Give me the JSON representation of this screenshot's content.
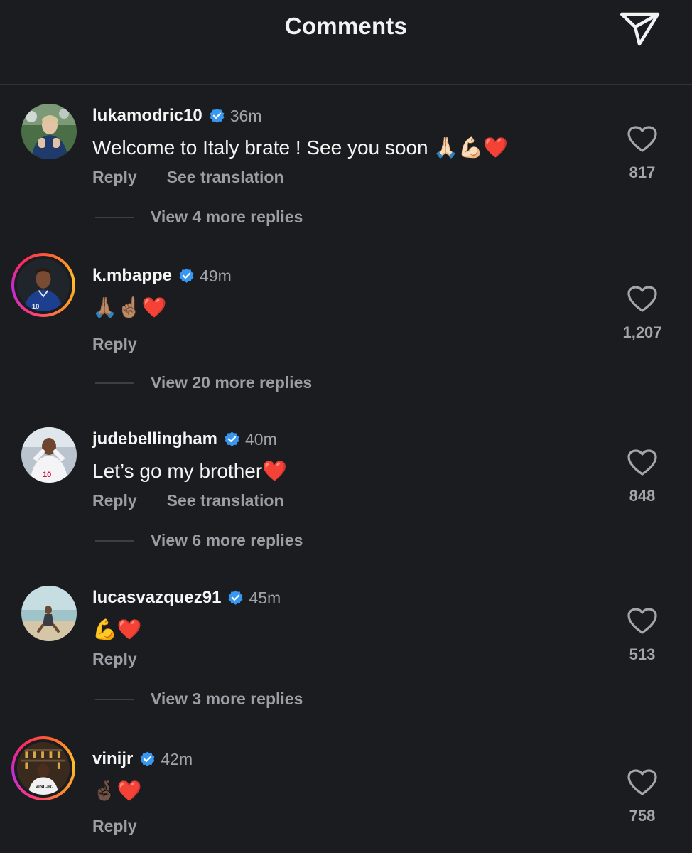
{
  "header": {
    "title": "Comments"
  },
  "comments": [
    {
      "username": "lukamodric10",
      "time": "36m",
      "text": "Welcome to Italy brate ! See you soon 🙏🏻💪🏻❤️",
      "reply_label": "Reply",
      "translate_label": "See translation",
      "replies_label": "View 4 more replies",
      "likes": "817"
    },
    {
      "username": "k.mbappe",
      "time": "49m",
      "text": "🙏🏽☝🏽❤️",
      "reply_label": "Reply",
      "replies_label": "View 20 more replies",
      "likes": "1,207"
    },
    {
      "username": "judebellingham",
      "time": "40m",
      "text": "Let’s go my brother❤️",
      "reply_label": "Reply",
      "translate_label": "See translation",
      "replies_label": "View 6 more replies",
      "likes": "848"
    },
    {
      "username": "lucasvazquez91",
      "time": "45m",
      "text": "💪❤️",
      "reply_label": "Reply",
      "replies_label": "View 3 more replies",
      "likes": "513"
    },
    {
      "username": "vinijr",
      "time": "42m",
      "text": "🤞🏿❤️",
      "reply_label": "Reply",
      "likes": "758"
    }
  ],
  "colors": {
    "background": "#1b1c1f",
    "verified_badge": "#3897f0",
    "muted_text": "#9b9ea4",
    "story_ring_start": "#ff2a5f",
    "story_ring_end": "#ffbf2a"
  },
  "icons": {
    "header_action": "send-icon",
    "like": "heart-outline-icon",
    "badge": "verified-badge-icon"
  }
}
